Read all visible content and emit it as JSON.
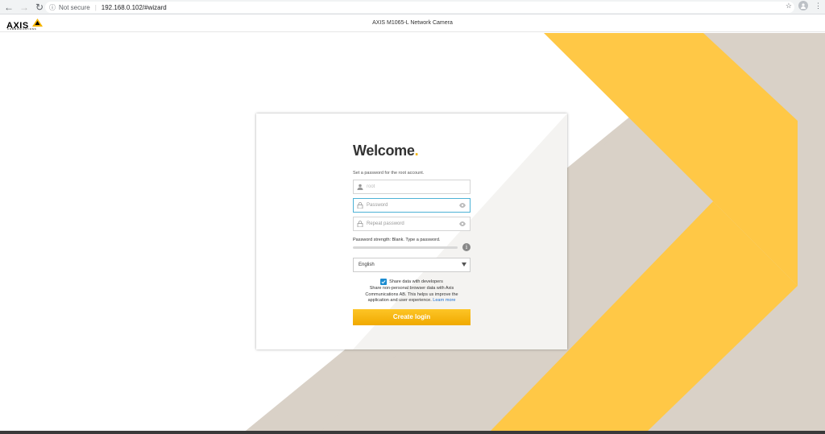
{
  "browser": {
    "security_label": "Not secure",
    "url": "192.168.0.102/#wizard",
    "back_icon": "back-arrow-icon",
    "forward_icon": "forward-arrow-icon",
    "reload_icon": "reload-icon",
    "star_icon": "bookmark-star-icon",
    "menu_icon": "kebab-menu-icon"
  },
  "header": {
    "logo_text": "AXIS",
    "logo_subtext": "COMMUNICATIONS",
    "title": "AXIS M1065-L Network Camera"
  },
  "wizard": {
    "welcome": "Welcome",
    "welcome_dot": ".",
    "hint": "Set a password for the root account.",
    "username_placeholder": "root",
    "password_placeholder": "Password",
    "repeat_placeholder": "Repeat password",
    "strength_label": "Password strength: Blank. Type a password.",
    "info_icon_glyph": "i",
    "language": "English",
    "share_label": "Share data with developers",
    "share_checked": true,
    "share_desc": "Share non-personal browser data with Axis Communications AB. This helps us improve the application and user experience.",
    "learn_more": "Learn more",
    "create_button": "Create login"
  },
  "colors": {
    "accent_yellow": "#FFCC33",
    "stripe_gray": "#D9D1C7",
    "button_yellow": "#F5B400",
    "focus_blue": "#4DB2D6"
  }
}
